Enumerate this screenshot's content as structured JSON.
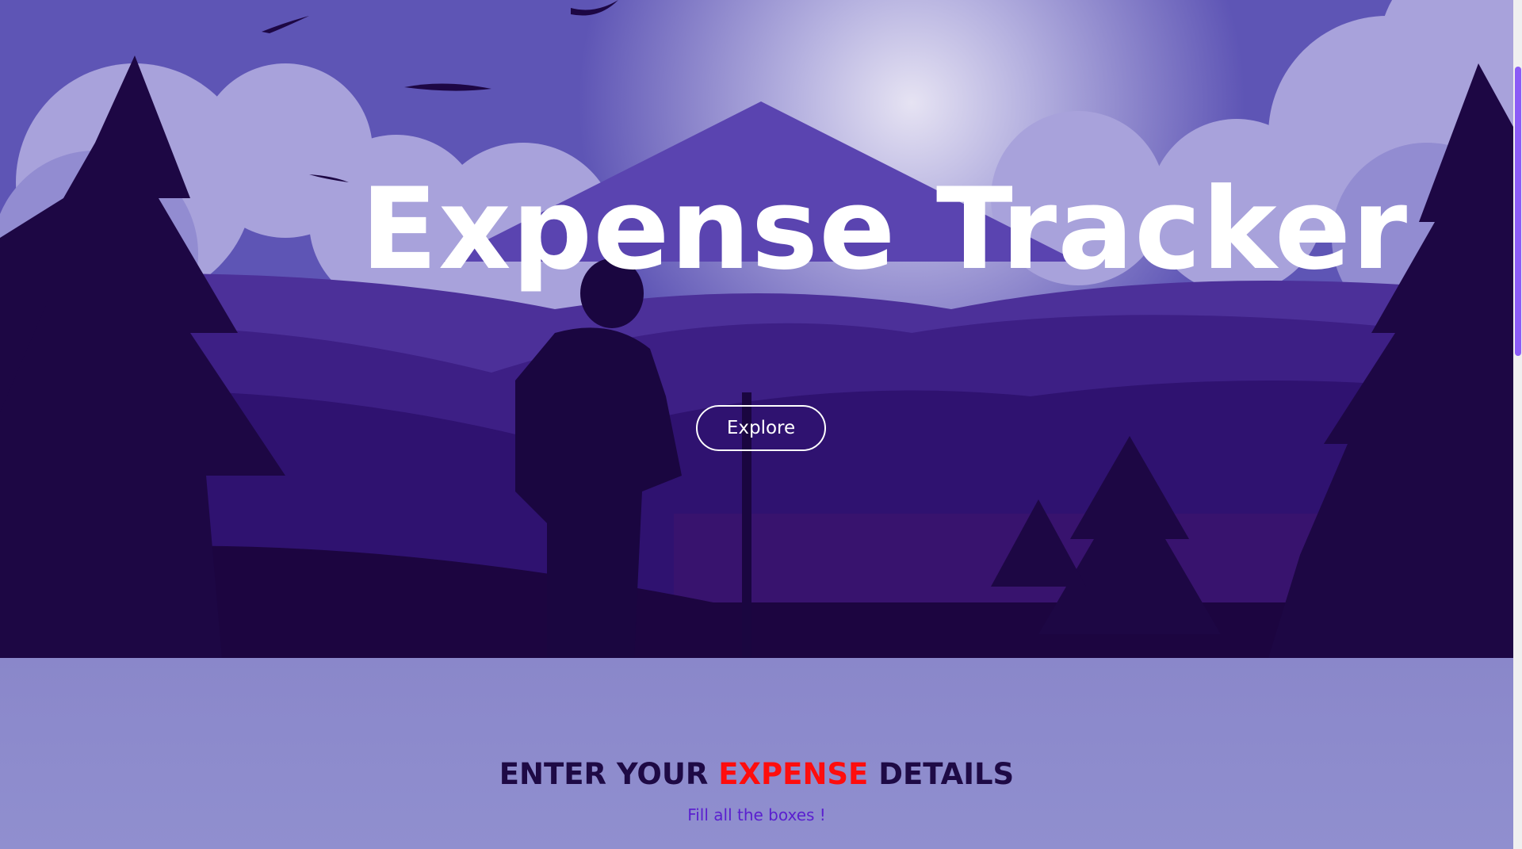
{
  "hero": {
    "title": "Expense Tracker",
    "explore_label": "Explore"
  },
  "section": {
    "heading_part1": "ENTER YOUR ",
    "heading_accent": "EXPENSE",
    "heading_part2": " DETAILS",
    "subtitle": "Fill all the boxes !"
  },
  "colors": {
    "sky": "#5e55b5",
    "accent_red": "#ff0d0d",
    "heading_dark": "#1e0a45",
    "subtitle_purple": "#5a1fcf",
    "section_bg": "#8b89cb"
  },
  "icons": [
    "bird-icon",
    "hiker-illustration",
    "tree-illustration",
    "mountain-illustration"
  ]
}
